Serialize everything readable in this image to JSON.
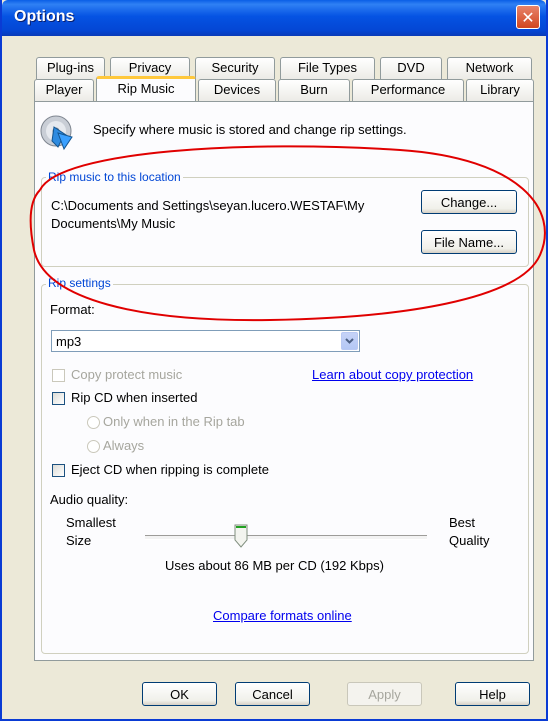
{
  "window": {
    "title": "Options"
  },
  "tabs_row1": [
    {
      "label": "Plug-ins"
    },
    {
      "label": "Privacy"
    },
    {
      "label": "Security"
    },
    {
      "label": "File Types"
    },
    {
      "label": "DVD"
    },
    {
      "label": "Network"
    }
  ],
  "tabs_row2": [
    {
      "label": "Player"
    },
    {
      "label": "Rip Music",
      "active": true
    },
    {
      "label": "Devices"
    },
    {
      "label": "Burn"
    },
    {
      "label": "Performance"
    },
    {
      "label": "Library"
    }
  ],
  "header": {
    "description": "Specify where music is stored and change rip settings."
  },
  "rip_location": {
    "group_label": "Rip music to this location",
    "path_line1": "C:\\Documents and Settings\\seyan.lucero.WESTAF\\My",
    "path_line2": "Documents\\My Music",
    "change_button": "Change...",
    "file_name_button": "File Name..."
  },
  "rip_settings": {
    "group_label": "Rip settings",
    "format_label": "Format:",
    "format_value": "mp3",
    "copy_protect": {
      "label": "Copy protect music",
      "checked": false,
      "enabled": false
    },
    "learn_link": "Learn about copy protection",
    "rip_cd_inserted": {
      "label": "Rip CD when inserted",
      "checked": false
    },
    "option_rip_tab": "Only when in the Rip tab",
    "option_always": "Always",
    "eject_cd": {
      "label": "Eject CD when ripping is complete",
      "checked": false
    },
    "audio_quality_label": "Audio quality:",
    "smallest_line1": "Smallest",
    "smallest_line2": "Size",
    "best_line1": "Best",
    "best_line2": "Quality",
    "quality_level": 0.33,
    "usage_text": "Uses about 86 MB per CD (192 Kbps)",
    "compare_link": "Compare formats online"
  },
  "footer": {
    "ok": "OK",
    "cancel": "Cancel",
    "apply": "Apply",
    "help": "Help"
  },
  "colors": {
    "titlebar": "#0553e3",
    "group_label": "#0046d5",
    "link": "#0000ee",
    "tab_highlight": "#ffc83c",
    "annotation": "#e00000"
  }
}
